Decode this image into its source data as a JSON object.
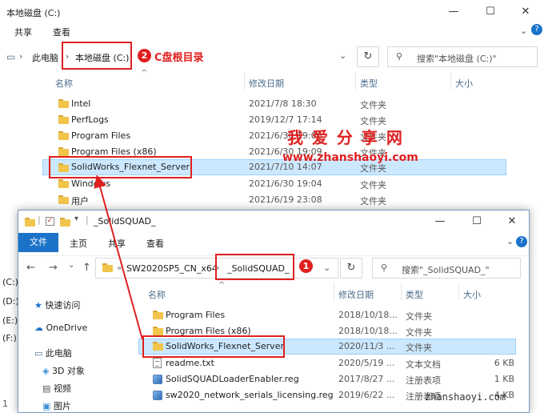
{
  "back_window": {
    "title": "本地磁盘 (C:)",
    "controls": {
      "minimize": "—",
      "maximize": "☐",
      "close": "✕"
    },
    "ribbon_tabs": [
      "共享",
      "查看"
    ],
    "breadcrumb": {
      "root": "此电脑",
      "current": "本地磁盘 (C:)"
    },
    "search_placeholder": "搜索\"本地磁盘 (C:)\"",
    "columns": {
      "name": "名称",
      "date": "修改日期",
      "type": "类型",
      "size": "大小"
    },
    "rows": [
      {
        "name": "Intel",
        "date": "2021/7/8 18:30",
        "type": "文件夹"
      },
      {
        "name": "PerfLogs",
        "date": "2019/12/7 17:14",
        "type": "文件夹"
      },
      {
        "name": "Program Files",
        "date": "2021/6/30 19:06",
        "type": "文件夹"
      },
      {
        "name": "Program Files (x86)",
        "date": "2021/6/30 19:09",
        "type": "文件夹"
      },
      {
        "name": "SolidWorks_Flexnet_Server",
        "date": "2021/7/10 14:07",
        "type": "文件夹"
      },
      {
        "name": "Windows",
        "date": "2021/6/30 19:04",
        "type": "文件夹"
      },
      {
        "name": "用户",
        "date": "2021/6/19 23:08",
        "type": "文件夹"
      }
    ],
    "annotation": {
      "badge": "2",
      "text": "C盘根目录"
    }
  },
  "watermark": {
    "line1": "我 爱 分 享 网",
    "line2": "www.zhanshaoyi.com",
    "corner": "zhanshaoyi.com"
  },
  "front_window": {
    "title": "_SolidSQUAD_",
    "controls": {
      "minimize": "—",
      "maximize": "☐",
      "close": "✕"
    },
    "ribbon_tabs": {
      "file": "文件",
      "home": "主页",
      "share": "共享",
      "view": "查看"
    },
    "breadcrumb": {
      "parent": "SW2020SP5_CN_x64",
      "current": "_SolidSQUAD_"
    },
    "search_placeholder": "搜索\"_SolidSQUAD_\"",
    "columns": {
      "name": "名称",
      "date": "修改日期",
      "type": "类型",
      "size": "大小"
    },
    "rows": [
      {
        "name": "Program Files",
        "date": "2018/10/18...",
        "type": "文件夹",
        "size": "",
        "icon": "folder-icon"
      },
      {
        "name": "Program Files (x86)",
        "date": "2018/10/18...",
        "type": "文件夹",
        "size": "",
        "icon": "folder-icon"
      },
      {
        "name": "SolidWorks_Flexnet_Server",
        "date": "2020/11/3 ...",
        "type": "文件夹",
        "size": "",
        "icon": "folder-icon"
      },
      {
        "name": "readme.txt",
        "date": "2020/5/19 ...",
        "type": "文本文档",
        "size": "6 KB",
        "icon": "text-file-icon"
      },
      {
        "name": "SolidSQUADLoaderEnabler.reg",
        "date": "2017/8/27 ...",
        "type": "注册表项",
        "size": "1 KB",
        "icon": "registry-icon"
      },
      {
        "name": "sw2020_network_serials_licensing.reg",
        "date": "2019/6/22 ...",
        "type": "注册表项",
        "size": "4 KB",
        "icon": "registry-icon"
      }
    ],
    "nav": [
      "快速访问",
      "OneDrive",
      "此电脑",
      "3D 对象",
      "视频",
      "图片"
    ],
    "drives": [
      "(C:)",
      "(D:)",
      "(E:)",
      "(F:)"
    ],
    "status_fragment": "1",
    "annotation": {
      "badge": "1"
    }
  }
}
